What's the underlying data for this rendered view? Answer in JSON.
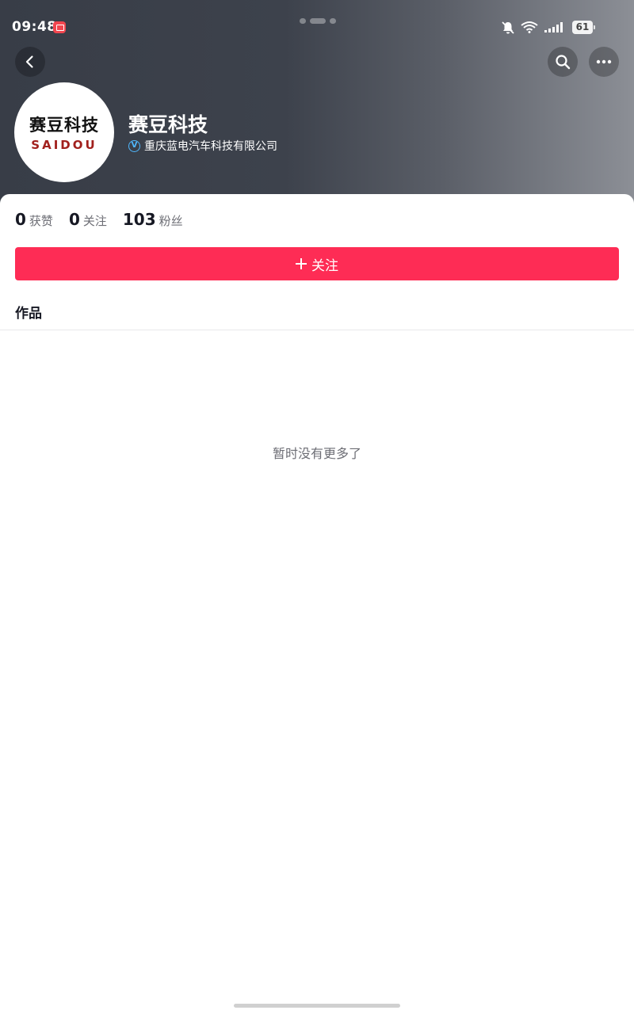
{
  "status_bar": {
    "time": "09:48",
    "battery": "61",
    "icons": [
      "app-notification-icon",
      "bell-off-icon",
      "wifi-icon",
      "signal-icon",
      "battery-icon"
    ]
  },
  "header": {
    "icons": [
      "back-arrow-icon",
      "search-icon",
      "more-icon"
    ]
  },
  "profile": {
    "avatar_text_cn": "赛豆科技",
    "avatar_text_en": "SAIDOU",
    "name": "赛豆科技",
    "verify_badge": "V",
    "company": "重庆蓝电汽车科技有限公司"
  },
  "stats": [
    {
      "value": "0",
      "label": "获赞"
    },
    {
      "value": "0",
      "label": "关注"
    },
    {
      "value": "103",
      "label": "粉丝"
    }
  ],
  "follow_button": {
    "label": "关注"
  },
  "tabs": {
    "works": "作品"
  },
  "empty_message": "暂时没有更多了",
  "colors": {
    "accent": "#fe2c55",
    "verify": "#4fb8ff",
    "header_dark": "#383d47",
    "header_light": "#8c8f96"
  }
}
